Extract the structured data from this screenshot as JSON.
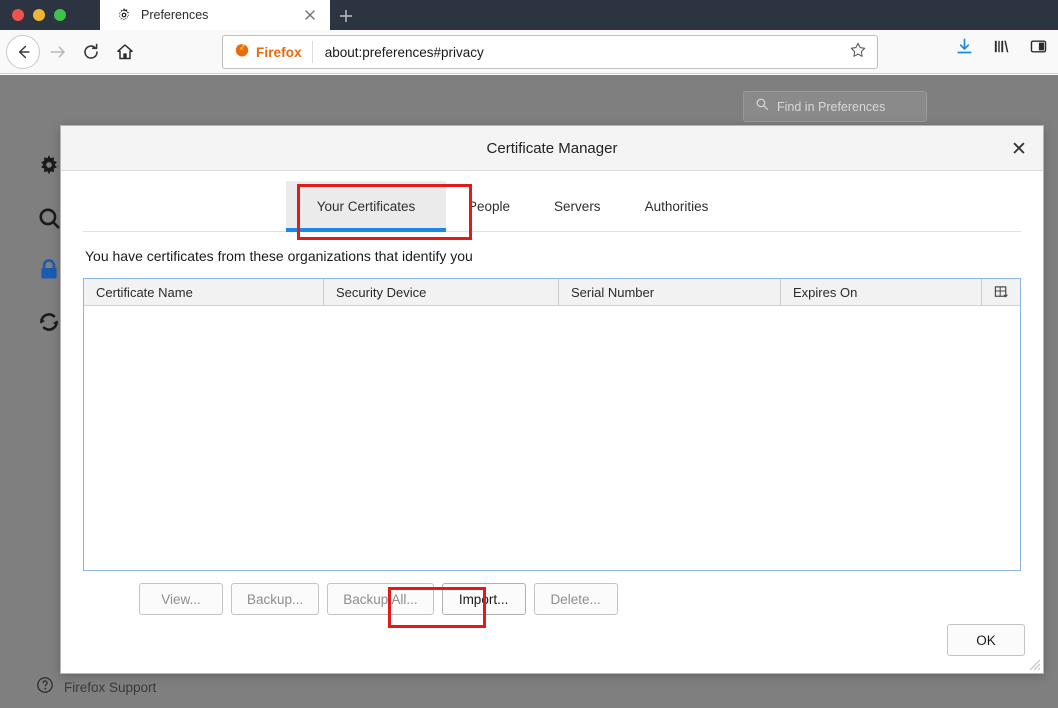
{
  "browser": {
    "window_controls": [
      "close",
      "minimize",
      "maximize"
    ],
    "tab": {
      "title": "Preferences",
      "favicon": "gear-icon",
      "close_label": "×"
    },
    "new_tab_label": "+",
    "nav": {
      "back": "back-arrow-icon",
      "forward": "forward-arrow-icon",
      "reload": "reload-icon",
      "home": "home-icon"
    },
    "urlbar": {
      "identity_label": "Firefox",
      "url": "about:preferences#privacy",
      "bookmark_icon": "star-icon"
    },
    "toolbar_right": [
      "download-icon",
      "library-icon",
      "sidebar-icon"
    ]
  },
  "prefs_page": {
    "search": {
      "placeholder": "Find in Preferences",
      "icon": "search-icon"
    },
    "sidebar_icons": [
      "gear-icon",
      "search-icon",
      "lock-icon",
      "sync-icon"
    ],
    "support_link": "Firefox Support",
    "support_icon": "question-circle-icon",
    "accent_color": "#1b5bb0"
  },
  "dialog": {
    "title": "Certificate Manager",
    "close_label": "✕",
    "tabs": [
      {
        "label": "Your Certificates",
        "active": true
      },
      {
        "label": "People",
        "active": false
      },
      {
        "label": "Servers",
        "active": false
      },
      {
        "label": "Authorities",
        "active": false
      }
    ],
    "active_tab_underline_color": "#1b8ae5",
    "description": "You have certificates from these organizations that identify you",
    "table": {
      "columns": [
        "Certificate Name",
        "Security Device",
        "Serial Number",
        "Expires On"
      ],
      "column_picker_icon": "column-picker-icon",
      "rows": []
    },
    "buttons": [
      {
        "label": "View...",
        "enabled": false
      },
      {
        "label": "Backup...",
        "enabled": false
      },
      {
        "label": "Backup All...",
        "enabled": false
      },
      {
        "label": "Import...",
        "enabled": true
      },
      {
        "label": "Delete...",
        "enabled": false
      }
    ],
    "ok_label": "OK"
  },
  "annotations": {
    "color": "#e01b1b",
    "targets": [
      "Your Certificates tab",
      "Import... button"
    ]
  }
}
